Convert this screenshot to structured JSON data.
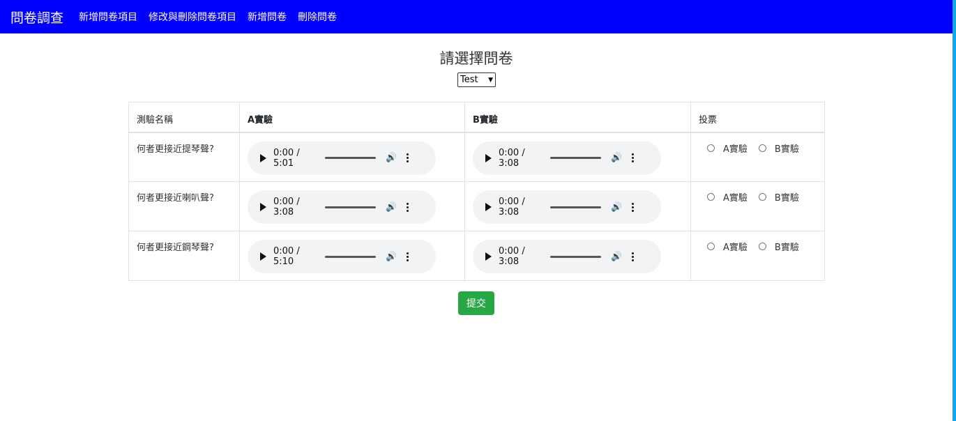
{
  "navbar": {
    "brand": "問卷調查",
    "links": [
      "新增問卷項目",
      "修改與刪除問卷項目",
      "新增問卷",
      "刪除問卷"
    ]
  },
  "page": {
    "title": "請選擇問卷",
    "select_value": "Test"
  },
  "table": {
    "headers": [
      "測驗名稱",
      "A實驗",
      "B實驗",
      "投票"
    ],
    "rows": [
      {
        "question": "何者更接近提琴聲?",
        "a_time": "0:00 / 5:01",
        "b_time": "0:00 / 3:08",
        "opt_a": "A實驗",
        "opt_b": "B實驗"
      },
      {
        "question": "何者更接近喇叭聲?",
        "a_time": "0:00 / 3:08",
        "b_time": "0:00 / 3:08",
        "opt_a": "A實驗",
        "opt_b": "B實驗"
      },
      {
        "question": "何者更接近鋼琴聲?",
        "a_time": "0:00 / 5:10",
        "b_time": "0:00 / 3:08",
        "opt_a": "A實驗",
        "opt_b": "B實驗"
      }
    ]
  },
  "submit_label": "提交",
  "colors": {
    "navbar": "#0000ff",
    "submit": "#28a745"
  }
}
